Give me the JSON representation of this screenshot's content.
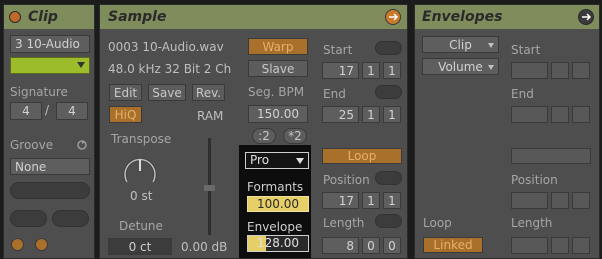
{
  "clip": {
    "title": "Clip",
    "name": "3 10-Audio",
    "signature_label": "Signature",
    "sig_num": "4",
    "sig_slash": "/",
    "sig_den": "4",
    "groove_label": "Groove",
    "groove_value": "None"
  },
  "sample": {
    "title": "Sample",
    "filename": "0003 10-Audio.wav",
    "info": "48.0 kHz 32 Bit 2 Ch",
    "edit": "Edit",
    "save": "Save",
    "rev": "Rev.",
    "hiq": "HiQ",
    "ram": "RAM",
    "transpose_label": "Transpose",
    "transpose_value": "0 st",
    "detune_label": "Detune",
    "detune_value": "0 ct",
    "gain_value": "0.00 dB",
    "warp": "Warp",
    "slave": "Slave",
    "seg_bpm": "Seg. BPM",
    "bpm": "150.00",
    "half": ":2",
    "double": "*2",
    "warp_mode": "Pro",
    "formants_label": "Formants",
    "formants_value": "100.00",
    "envelope_label": "Envelope",
    "envelope_value": "128.00",
    "start_label": "Start",
    "start": [
      "17",
      "1",
      "1"
    ],
    "end_label": "End",
    "end": [
      "25",
      "1",
      "1"
    ],
    "loop": "Loop",
    "position_label": "Position",
    "position": [
      "17",
      "1",
      "1"
    ],
    "length_label": "Length",
    "length": [
      "8",
      "0",
      "0"
    ]
  },
  "envelopes": {
    "title": "Envelopes",
    "device": "Clip",
    "control": "Volume",
    "start_label": "Start",
    "end_label": "End",
    "position_label": "Position",
    "loop_label": "Loop",
    "length_label": "Length",
    "linked": "Linked"
  },
  "colors": {
    "header": "#7f8c5c",
    "panel": "#4e4e4e",
    "orange": "#a9702b",
    "highlight": "#e6cf66"
  }
}
